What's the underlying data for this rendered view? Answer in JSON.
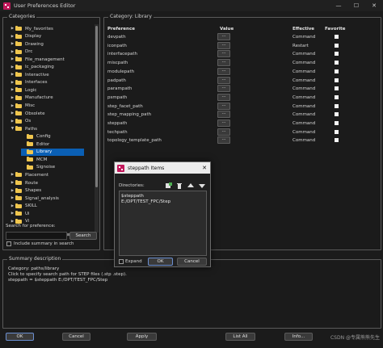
{
  "window": {
    "title": "User Preferences Editor",
    "minimize": "—",
    "maximize": "☐",
    "close": "✕"
  },
  "categories": {
    "label": "Categories",
    "items": [
      {
        "label": "My_favorites",
        "expander": "▶"
      },
      {
        "label": "Display",
        "expander": "▶"
      },
      {
        "label": "Drawing",
        "expander": "▶"
      },
      {
        "label": "Drc",
        "expander": "▶"
      },
      {
        "label": "File_management",
        "expander": "▶"
      },
      {
        "label": "Ic_packaging",
        "expander": "▶"
      },
      {
        "label": "Interactive",
        "expander": "▶"
      },
      {
        "label": "Interfaces",
        "expander": "▶"
      },
      {
        "label": "Logic",
        "expander": "▶"
      },
      {
        "label": "Manufacture",
        "expander": "▶"
      },
      {
        "label": "Misc",
        "expander": "▶"
      },
      {
        "label": "Obsolete",
        "expander": "▶"
      },
      {
        "label": "Os",
        "expander": "▶"
      },
      {
        "label": "Paths",
        "expander": "▼"
      },
      {
        "label": "Config",
        "expander": ""
      },
      {
        "label": "Editor",
        "expander": ""
      },
      {
        "label": "Library",
        "expander": "",
        "selected": true
      },
      {
        "label": "MCM",
        "expander": ""
      },
      {
        "label": "Signoise",
        "expander": ""
      },
      {
        "label": "Placement",
        "expander": "▶"
      },
      {
        "label": "Route",
        "expander": "▶"
      },
      {
        "label": "Shapes",
        "expander": "▶"
      },
      {
        "label": "Signal_analysis",
        "expander": "▶"
      },
      {
        "label": "SKILL",
        "expander": "▶"
      },
      {
        "label": "Ui",
        "expander": "▶"
      },
      {
        "label": "Vi",
        "expander": "▶"
      }
    ]
  },
  "search": {
    "label": "Search for preference:",
    "value": "",
    "button": "Search",
    "include_summary": "Include summary in search"
  },
  "category_panel": {
    "label": "Category:  Library",
    "headers": {
      "preference": "Preference",
      "value": "Value",
      "effective": "Effective",
      "favorite": "Favorite"
    },
    "value_button": "...",
    "rows": [
      {
        "name": "devpath",
        "effective": "Command"
      },
      {
        "name": "iconpath",
        "effective": "Restart"
      },
      {
        "name": "interfacepath",
        "effective": "Command"
      },
      {
        "name": "miscpath",
        "effective": "Command"
      },
      {
        "name": "modulepath",
        "effective": "Command"
      },
      {
        "name": "padpath",
        "effective": "Command"
      },
      {
        "name": "parampath",
        "effective": "Command"
      },
      {
        "name": "psmpath",
        "effective": "Command"
      },
      {
        "name": "step_facet_path",
        "effective": "Command"
      },
      {
        "name": "step_mapping_path",
        "effective": "Command"
      },
      {
        "name": "steppath",
        "effective": "Command"
      },
      {
        "name": "techpath",
        "effective": "Command"
      },
      {
        "name": "topology_template_path",
        "effective": "Command"
      }
    ]
  },
  "summary": {
    "label": "Summary description",
    "lines": [
      "Category: paths/library",
      "Click to specify search path for STEP files (.stp .step).",
      "steppath = $steppath E:/DPT/TEST_FPC/Step"
    ]
  },
  "footer": {
    "ok": "OK",
    "cancel": "Cancel",
    "apply": "Apply",
    "list_all": "List All",
    "info": "Info..."
  },
  "dialog": {
    "title": "steppath Items",
    "close": "✕",
    "directories_label": "Directories:",
    "items": [
      "$steppath",
      "E:/DPT/TEST_FPC/Step"
    ],
    "expand_label": "Expand",
    "ok": "OK",
    "cancel": "Cancel"
  },
  "watermark": "CSDN @专属熊熊先生"
}
